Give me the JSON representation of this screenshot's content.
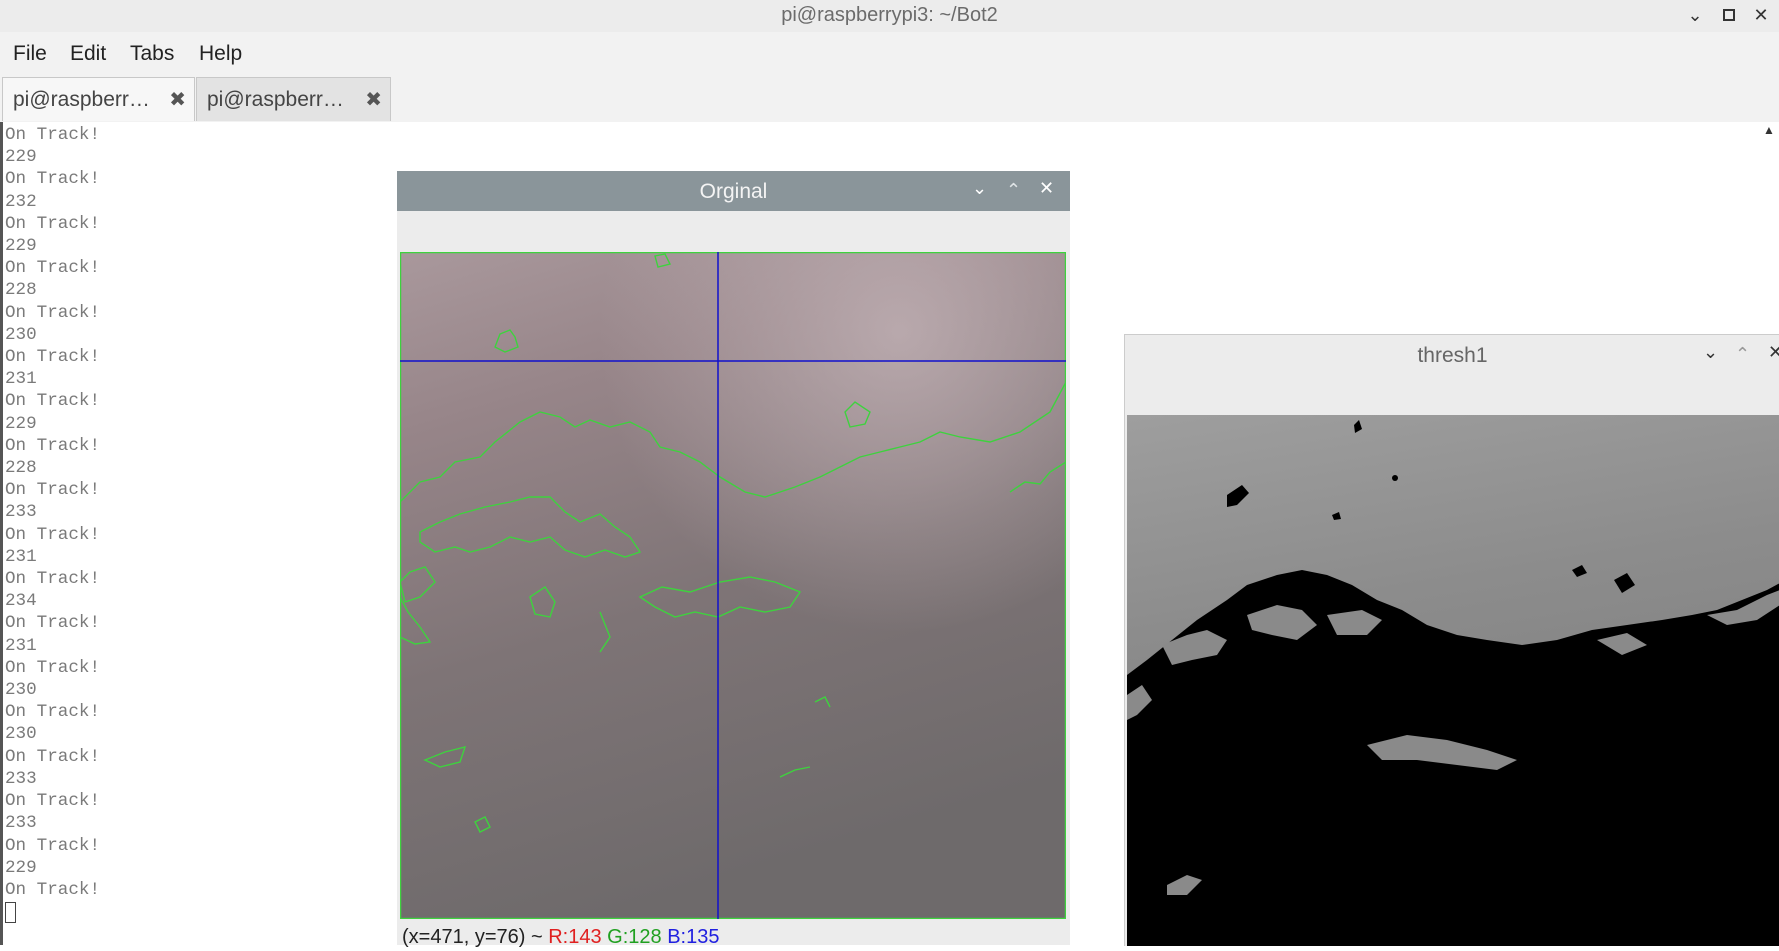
{
  "window": {
    "title": "pi@raspberrypi3: ~/Bot2",
    "minimize_icon": "chevron-down-icon",
    "maximize_icon": "square-icon",
    "close_icon": "close-icon"
  },
  "menu": [
    "File",
    "Edit",
    "Tabs",
    "Help"
  ],
  "tabs": [
    {
      "label": "pi@raspberr…",
      "close": "✖"
    },
    {
      "label": "pi@raspberr…",
      "close": "✖"
    }
  ],
  "terminal": {
    "lines": [
      "On Track!",
      "229",
      "On Track!",
      "232",
      "On Track!",
      "229",
      "On Track!",
      "228",
      "On Track!",
      "230",
      "On Track!",
      "231",
      "On Track!",
      "229",
      "On Track!",
      "228",
      "On Track!",
      "233",
      "On Track!",
      "231",
      "On Track!",
      "234",
      "On Track!",
      "231",
      "On Track!",
      "230",
      "On Track!",
      "230",
      "On Track!",
      "233",
      "On Track!",
      "233",
      "On Track!",
      "229",
      "On Track!"
    ]
  },
  "orig_window": {
    "title": "Orginal",
    "status": {
      "coords": "(x=471, y=76) ~",
      "r": "R:143",
      "g": "G:128",
      "b": "B:135"
    }
  },
  "thresh_window": {
    "title": "thresh1"
  },
  "colors": {
    "orig_titlebar": "#8a959a",
    "contour": "#3ed23e",
    "crosshair": "#1010cc",
    "r": "#e02020",
    "g": "#20a020",
    "b": "#2020e0"
  }
}
